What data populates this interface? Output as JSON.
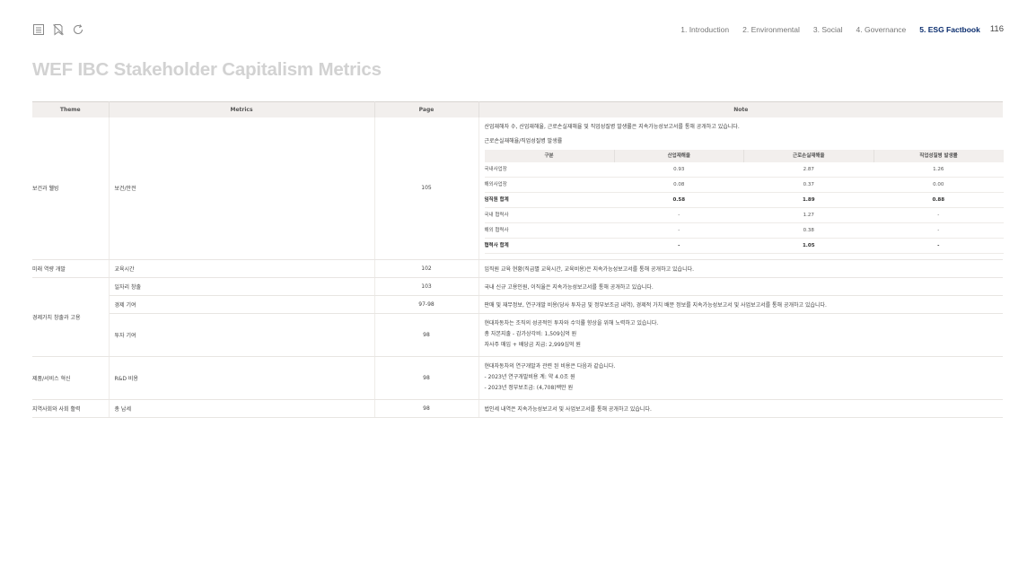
{
  "toolbar": {
    "icons": [
      "list-icon",
      "bookmark-icon",
      "refresh-icon"
    ]
  },
  "nav": {
    "items": [
      {
        "label": "1. Introduction"
      },
      {
        "label": "2. Environmental"
      },
      {
        "label": "3. Social"
      },
      {
        "label": "4. Governance"
      },
      {
        "label": "5. ESG Factbook"
      }
    ],
    "page_number": "116"
  },
  "title": "WEF IBC Stakeholder Capitalism Metrics",
  "table": {
    "headers": {
      "theme": "Theme",
      "metrics": "Metrics",
      "page": "Page",
      "note": "Note"
    },
    "health": {
      "theme": "보건과 웰빙",
      "metric": "보건/안전",
      "page": "105",
      "note_intro": "산업재해자 수, 산업재해율, 근로손실재해율 및 직업성질병 발생률은 지속가능성보고서를 통해 공개하고 있습니다.",
      "sub_title": "근로손실재해율/직업성질병 발생률",
      "inner_headers": [
        "구분",
        "산업재해율",
        "근로손실재해율",
        "직업성질병 발생률"
      ],
      "inner_rows": [
        [
          "국내사업장",
          "0.93",
          "2.87",
          "1.26"
        ],
        [
          "해외사업장",
          "0.08",
          "0.37",
          "0.00"
        ],
        [
          "임직원 합계",
          "0.58",
          "1.89",
          "0.88"
        ],
        [
          "국내 협력사",
          "-",
          "1.27",
          "-"
        ],
        [
          "해외 협력사",
          "-",
          "0.38",
          "-"
        ],
        [
          "협력사 합계",
          "-",
          "1.05",
          "-"
        ]
      ]
    },
    "future": {
      "theme": "미래 역량 개발",
      "metric": "교육시간",
      "page": "102",
      "note": "임직원 교육 현황(직급별 교육시간, 교육비용)은 지속가능성보고서를 통해 공개하고 있습니다."
    },
    "economic": {
      "theme": "경제가치 창출과 고용",
      "rows": [
        {
          "metric": "일자리 창출",
          "page": "103",
          "note": [
            "국내 신규 고용인원, 이직율은 지속가능성보고서를 통해 공개하고 있습니다."
          ]
        },
        {
          "metric": "경제 기여",
          "page": "97-98",
          "note": [
            "판매 및 재무정보, 연구개발 비용(당사 투자금 및 정부보조금 내역), 경제적 가치 배분 정보를 지속가능성보고서 및 사업보고서를 통해 공개하고 있습니다."
          ]
        },
        {
          "metric": "투자 기여",
          "page": "98",
          "note": [
            "현대자동차는 조직의 성공적인 투자와 수익률 향상을 위해 노력하고 있습니다.",
            "총 자본지출 - 감가상각비: 1,509십억 원",
            "자사주 매입 + 배당금 지급: 2,999십억 원"
          ]
        }
      ]
    },
    "product": {
      "theme": "제품/서비스 혁신",
      "metric": "R&D 비용",
      "page": "98",
      "note": [
        "현대자동차의 연구개발과 관련 된 비용은 다음과 같습니다.",
        "- 2023년 연구개발비용 계: 약 4.0조 원",
        "- 2023년 정부보조금: (4,708)백만 원"
      ]
    },
    "community": {
      "theme": "지역사회와 사회 활력",
      "metric": "총 납세",
      "page": "98",
      "note": "법인세 내역은 지속가능성보고서 및 사업보고서를 통해 공개하고 있습니다."
    }
  },
  "colors": {
    "accent": "#0a2d6e",
    "title_gray": "#d2d2d2",
    "header_bg": "#f2efed"
  }
}
